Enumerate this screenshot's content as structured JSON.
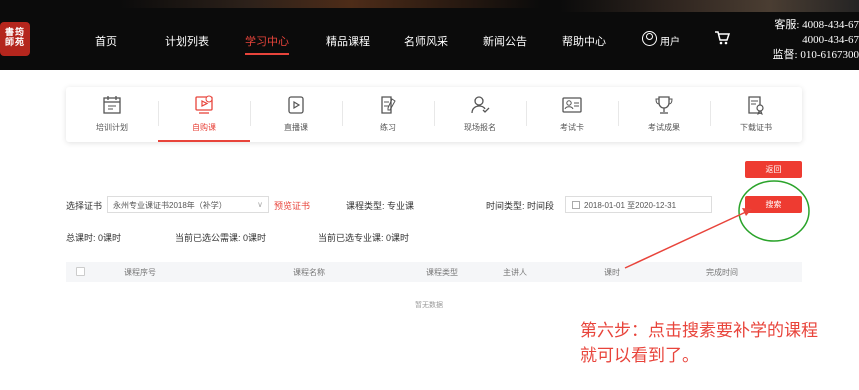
{
  "header": {
    "logo_text": "書筠\n師苑",
    "nav": [
      "首页",
      "计划列表",
      "学习中心",
      "精品课程",
      "名师风采",
      "新闻公告",
      "帮助中心"
    ],
    "active_nav": "学习中心",
    "user_name": "用户",
    "contact_lines": [
      "客服: 4008-434-67",
      "4000-434-67",
      "监督: 010-6167300"
    ]
  },
  "categories": {
    "items": [
      "培训计划",
      "自购课",
      "直播课",
      "练习",
      "现场报名",
      "考试卡",
      "考试成果",
      "下载证书"
    ],
    "active": "自购课",
    "icons": [
      "calendar-icon",
      "cart-course-icon",
      "live-icon",
      "practice-icon",
      "register-icon",
      "card-icon",
      "trophy-icon",
      "certificate-icon"
    ]
  },
  "actions": {
    "back_label": "返回",
    "search_label": "搜索"
  },
  "filters": {
    "cert_label": "选择证书",
    "cert_value": "永州专业课证书2018年（补学）",
    "preview_label": "预览证书",
    "course_type_label": "课程类型: 专业课",
    "time_type_label": "时间类型: 时间段",
    "date_range": "2018-01-01 至2020-12-31"
  },
  "summary": {
    "total": "总课时:   0课时",
    "public": "当前已选公需课:  0课时",
    "professional": "当前已选专业课:  0课时"
  },
  "table": {
    "headers": [
      "课程序号",
      "课程名称",
      "课程类型",
      "主讲人",
      "课时",
      "完成时间"
    ],
    "empty_text": "暂无数据"
  },
  "annotation": {
    "line1": "第六步：点击搜素要补学的课程",
    "line2": "就可以看到了。"
  },
  "colors": {
    "accent": "#e8443b",
    "highlight_circle": "#2aa32a"
  }
}
